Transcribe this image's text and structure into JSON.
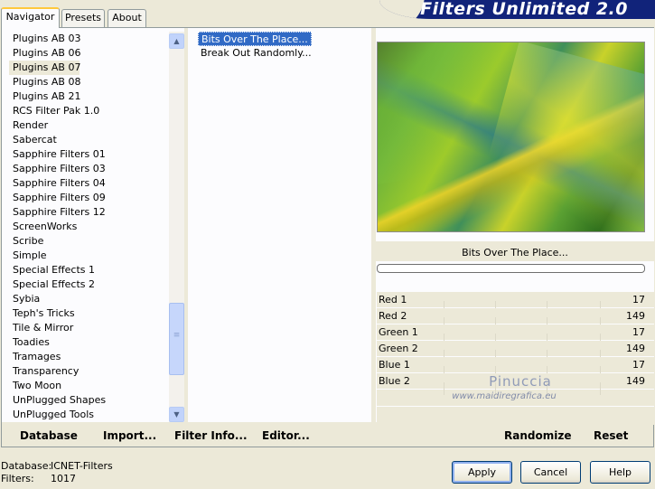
{
  "tabs": [
    {
      "label": "Navigator"
    },
    {
      "label": "Presets"
    },
    {
      "label": "About"
    }
  ],
  "banner": {
    "title": "Filters Unlimited 2.0"
  },
  "categories": [
    "Plugins AB 03",
    "Plugins AB 06",
    "Plugins AB 07",
    "Plugins AB 08",
    "Plugins AB 21",
    "RCS Filter Pak 1.0",
    "Render",
    "Sabercat",
    "Sapphire Filters 01",
    "Sapphire Filters 03",
    "Sapphire Filters 04",
    "Sapphire Filters 09",
    "Sapphire Filters 12",
    "ScreenWorks",
    "Scribe",
    "Simple",
    "Special Effects 1",
    "Special Effects 2",
    "Sybia",
    "Teph's Tricks",
    "Tile & Mirror",
    "Toadies",
    "Tramages",
    "Transparency",
    "Two Moon",
    "UnPlugged Shapes",
    "UnPlugged Tools"
  ],
  "selected_category": "Plugins AB 07",
  "filters": [
    "Bits Over The Place...",
    "Break Out Randomly..."
  ],
  "selected_filter": "Bits Over The Place...",
  "preview": {
    "caption": "Bits Over The Place...",
    "progress": 0
  },
  "params": [
    {
      "label": "Red 1",
      "value": "17"
    },
    {
      "label": "Red 2",
      "value": "149"
    },
    {
      "label": "Green 1",
      "value": "17"
    },
    {
      "label": "Green 2",
      "value": "149"
    },
    {
      "label": "Blue 1",
      "value": "17"
    },
    {
      "label": "Blue 2",
      "value": "149"
    }
  ],
  "watermark": {
    "name": "Pinuccia",
    "url": "www.maidiregrafica.eu"
  },
  "toolbar": {
    "database": "Database",
    "import": "Import...",
    "filter_info": "Filter Info...",
    "editor": "Editor...",
    "randomize": "Randomize",
    "reset": "Reset"
  },
  "footer": {
    "database_label": "Database:",
    "database_value": "ICNET-Filters",
    "filters_label": "Filters:",
    "filters_value": "1017"
  },
  "buttons": {
    "apply": "Apply",
    "cancel": "Cancel",
    "help": "Help"
  },
  "icons": {
    "scroll_up": "chevron-up-icon",
    "scroll_down": "chevron-down-icon"
  },
  "colors": {
    "selection": "#316ac5",
    "banner": "#11237a",
    "panel": "#ece9d8"
  }
}
